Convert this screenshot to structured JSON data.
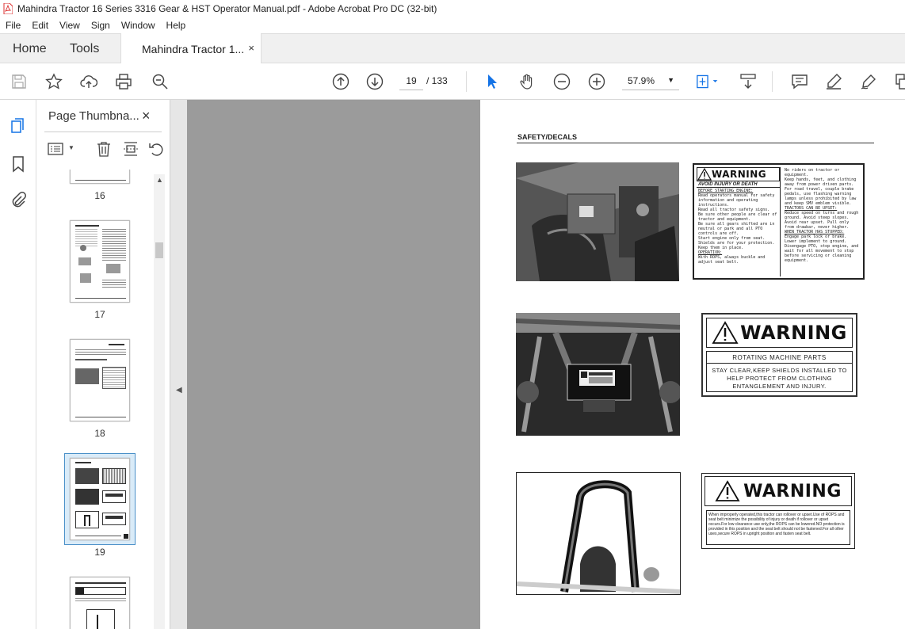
{
  "window": {
    "title": "Mahindra Tractor 16 Series 3316 Gear & HST  Operator  Manual.pdf - Adobe Acrobat Pro DC (32-bit)"
  },
  "menu": [
    "File",
    "Edit",
    "View",
    "Sign",
    "Window",
    "Help"
  ],
  "tabs": {
    "home": "Home",
    "tools": "Tools",
    "doc": "Mahindra Tractor 1...",
    "close": "×"
  },
  "toolbar": {
    "page_current": "19",
    "page_total": "/ 133",
    "zoom": "57.9%"
  },
  "panel": {
    "title": "Page Thumbna...",
    "close": "×",
    "thumbs": [
      {
        "label": "16",
        "selected": false
      },
      {
        "label": "17",
        "selected": false
      },
      {
        "label": "18",
        "selected": false
      },
      {
        "label": "19",
        "selected": true
      },
      {
        "label": "",
        "selected": false
      }
    ]
  },
  "page": {
    "section_title": "SAFETY/DECALS",
    "decal1": {
      "heading": "WARNING",
      "sub": "AVOID INJURY OR DEATH",
      "col1": [
        "BEFORE STARTING ENGINE:",
        "Read operators manual for safety information and operating instructions.",
        "Read all tractor safety signs.",
        "Be sure other people are clear of tractor and equipment.",
        "Be sure all gears shifted are in neutral or park and all PTO controls are off.",
        "Start engine only from seat.",
        "Shields are for your protection. Keep them in place.",
        "OPERATION:",
        "With ROPS, always buckle and adjust seat belt."
      ],
      "col2": [
        "No riders on tractor or equipment.",
        "Keep hands, feet, and clothing away from power driven parts.",
        "For road travel, couple brake pedals, use flashing warning lamps unless prohibited by law and keep SMV emblem visible.",
        "TRACTORS CAN BE UPSET:",
        "Reduce speed on turns and rough ground. Avoid steep slopes.",
        "Avoid rear upset. Pull only from drawbar, never higher.",
        "WHEN TRACTOR HAS STOPPED:",
        "Engage park lock or brake.",
        "Lower implement to ground.",
        "Disengage PTO, stop engine, and wait for all movement to stop before servicing or cleaning equipment."
      ]
    },
    "decal2": {
      "heading": "WARNING",
      "sub": "ROTATING MACHINE PARTS",
      "body": "STAY CLEAR,KEEP SHIELDS INSTALLED TO HELP PROTECT FROM CLOTHING ENTANGLEMENT AND INJURY."
    },
    "decal3": {
      "heading": "WARNING",
      "body": "When improperly operated,this tractor can rollover or upset.Use of ROPS and seat belt minimize the possibility of injury or death if rollover or upset occurs.For low clearance use only,the ROPS can be lowered.NO protection is provided in this position and the seat belt should not be fastened.For all other uses,secure ROPS in upright position and fasten seat belt."
    }
  }
}
